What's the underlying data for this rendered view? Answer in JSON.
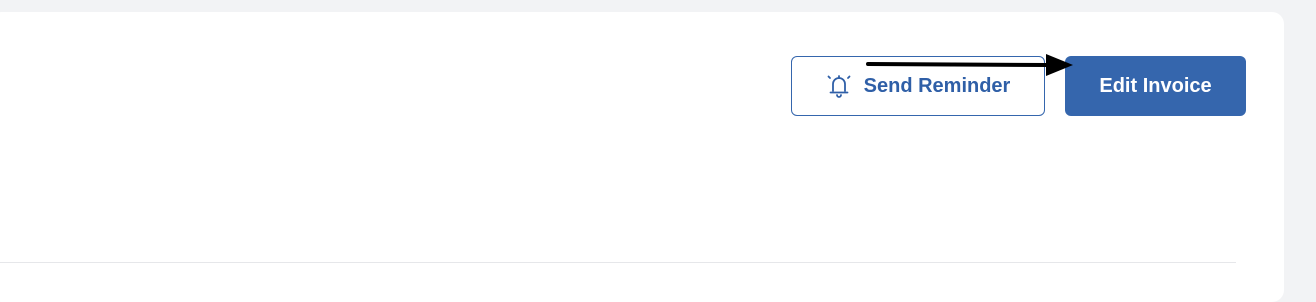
{
  "actions": {
    "send_reminder_label": "Send Reminder",
    "edit_invoice_label": "Edit Invoice",
    "send_reminder_icon": "bell-ringing-icon"
  },
  "colors": {
    "page_background": "#f2f3f5",
    "card_background": "#ffffff",
    "primary": "#3566ad",
    "divider": "#e6e7ea",
    "annotation_arrow": "#000000"
  }
}
